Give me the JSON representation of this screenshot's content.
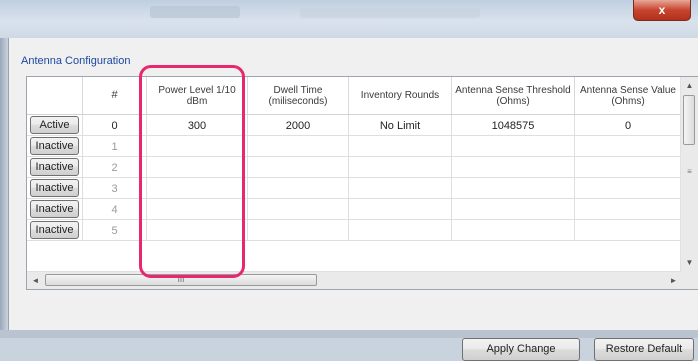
{
  "window": {
    "close_label": "x"
  },
  "section_title": "Antenna Configuration",
  "columns": [
    {
      "key": "state",
      "label": ""
    },
    {
      "key": "num",
      "label": "#"
    },
    {
      "key": "power",
      "label": "Power Level 1/10 dBm"
    },
    {
      "key": "dwell",
      "label": "Dwell Time (miliseconds)"
    },
    {
      "key": "rounds",
      "label": "Inventory Rounds"
    },
    {
      "key": "threshold",
      "label": "Antenna Sense Threshold (Ohms)"
    },
    {
      "key": "value",
      "label": "Antenna Sense Value (Ohms)"
    }
  ],
  "rows": [
    {
      "state": "Active",
      "num": "0",
      "power": "300",
      "dwell": "2000",
      "rounds": "No Limit",
      "threshold": "1048575",
      "value": "0"
    },
    {
      "state": "Inactive",
      "num": "1",
      "power": "",
      "dwell": "",
      "rounds": "",
      "threshold": "",
      "value": ""
    },
    {
      "state": "Inactive",
      "num": "2",
      "power": "",
      "dwell": "",
      "rounds": "",
      "threshold": "",
      "value": ""
    },
    {
      "state": "Inactive",
      "num": "3",
      "power": "",
      "dwell": "",
      "rounds": "",
      "threshold": "",
      "value": ""
    },
    {
      "state": "Inactive",
      "num": "4",
      "power": "",
      "dwell": "",
      "rounds": "",
      "threshold": "",
      "value": ""
    },
    {
      "state": "Inactive",
      "num": "5",
      "power": "",
      "dwell": "",
      "rounds": "",
      "threshold": "",
      "value": ""
    }
  ],
  "scrollbar": {
    "up": "▲",
    "down": "▼",
    "left": "◄",
    "right": "►",
    "right_marker": "≡",
    "h_grip": "III"
  },
  "buttons": {
    "apply": "Apply Change",
    "restore": "Restore Default"
  },
  "colors": {
    "highlight": "#e8286e",
    "section_title": "#1c48a0"
  }
}
